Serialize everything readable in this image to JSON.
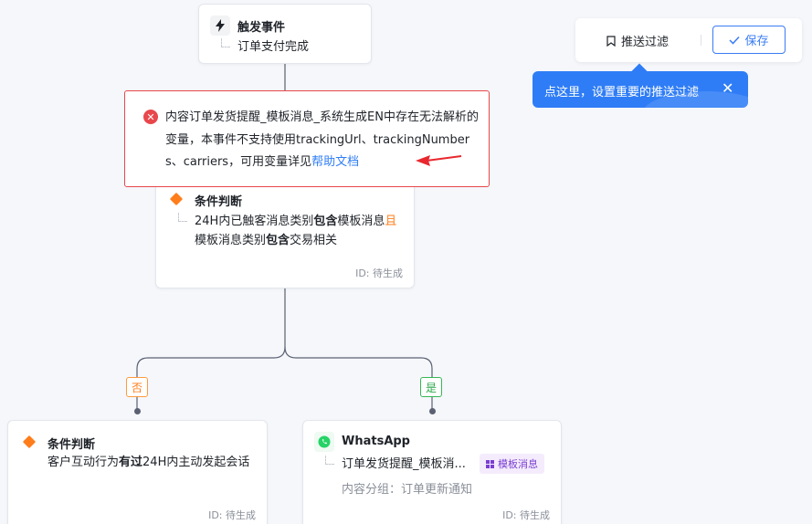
{
  "toolbar": {
    "filter_label": "推送过滤",
    "filter_icon": "bookmark-icon",
    "save_label": "保存",
    "save_icon": "check-icon"
  },
  "tooltip": {
    "text": "点这里，设置重要的推送过滤",
    "close": "✕"
  },
  "error": {
    "text": "内容订单发货提醒_模板消息_系统生成EN中存在无法解析的变量，本事件不支持使用trackingUrl、trackingNumbers、carriers，可用变量详见",
    "link": "帮助文档",
    "icon": "✕"
  },
  "nodes": {
    "trigger": {
      "title": "触发事件",
      "text": "订单支付完成",
      "icon": "lightning-icon"
    },
    "condition1": {
      "title": "条件判断",
      "line1_a": "24H内已触客消息类别",
      "line1_b": "包含",
      "line1_c": "模板消息",
      "line1_d": "且",
      "line2_a": "模板消息类别",
      "line2_b": "包含",
      "line2_c": "交易相关",
      "id": "ID: 待生成"
    },
    "condition2": {
      "title": "条件判断",
      "text_a": "客户互动行为",
      "text_b": "有过",
      "text_c": "24H内主动发起会话",
      "id": "ID: 待生成"
    },
    "whatsapp": {
      "title": "WhatsApp",
      "text": "订单发货提醒_模板消...",
      "tag": "模板消息",
      "group": "内容分组：订单更新通知",
      "id": "ID: 待生成"
    }
  },
  "branches": {
    "no": "否",
    "yes": "是"
  },
  "colors": {
    "primary": "#2f7df6",
    "error": "#e8474b",
    "condition": "#ff7d1a",
    "branch_no": "#ff7d1a",
    "branch_yes": "#2ba84a",
    "whatsapp": "#25d366"
  }
}
